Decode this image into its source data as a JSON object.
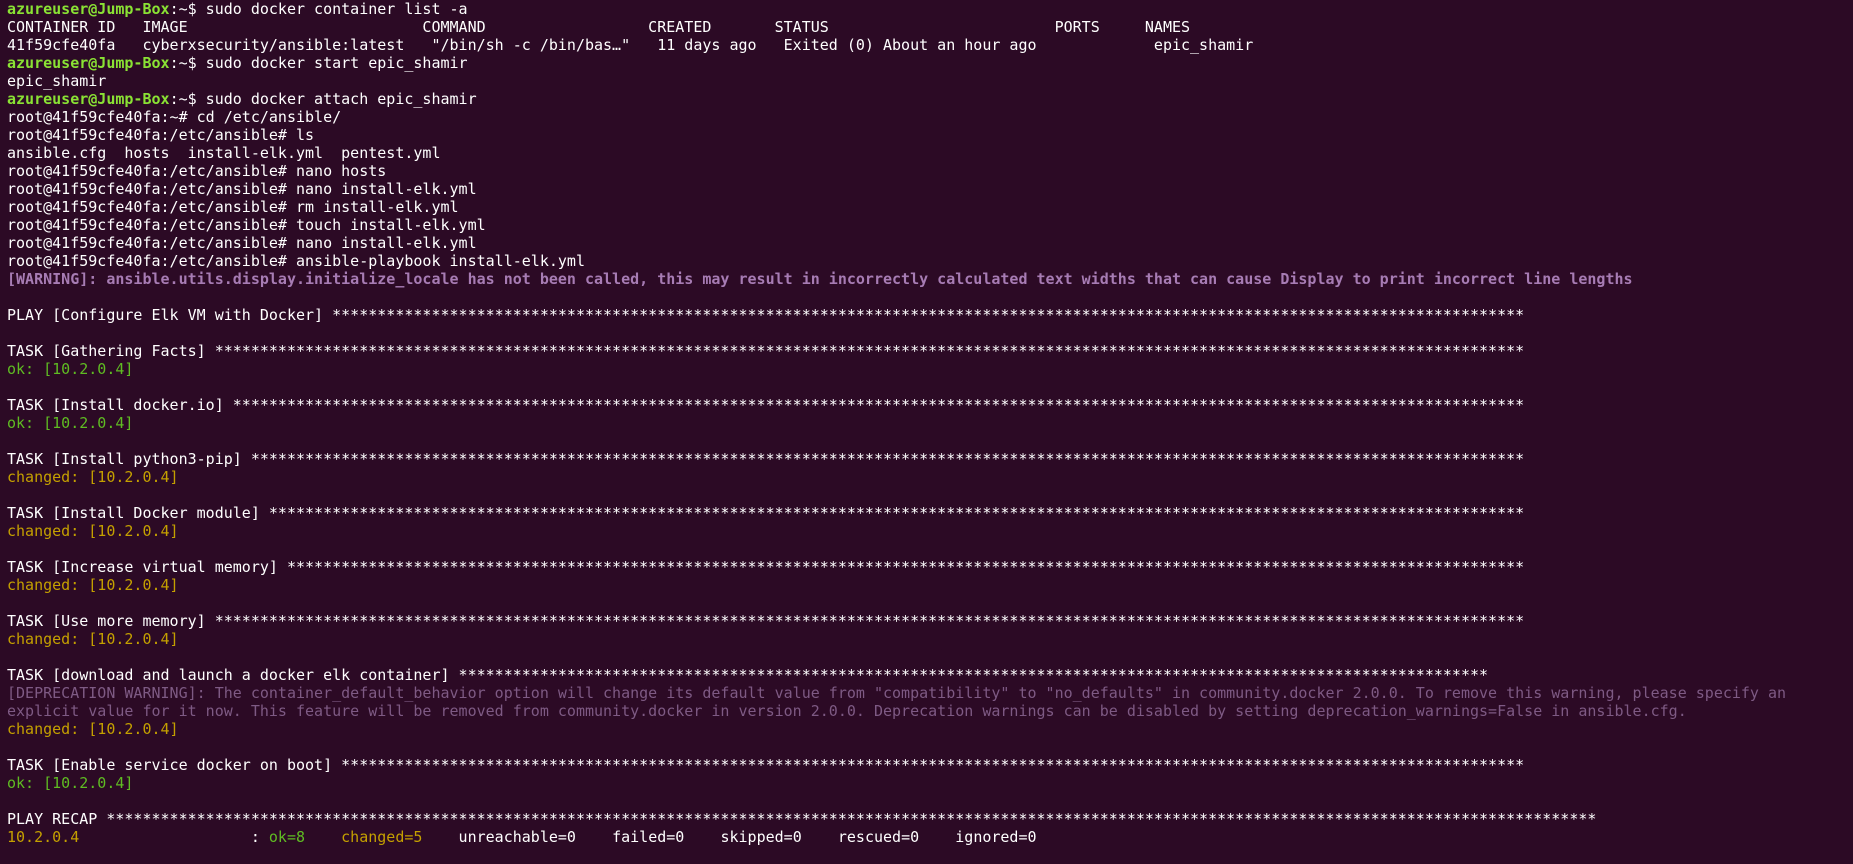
{
  "theme": {
    "background": "#2c0a25",
    "foreground": "#ffffff",
    "prompt_user": "#8ae234",
    "ok": "#5fbc22",
    "changed": "#c4a000",
    "warning": "#a77cb4",
    "deprecation": "#7e5a84"
  },
  "lines": [
    [
      {
        "t": "azureuser@Jump-Box",
        "c": "c-green bold"
      },
      {
        "t": ":~$ sudo docker container list -a",
        "c": "c-white"
      }
    ],
    [
      {
        "t": "CONTAINER ID   IMAGE                          COMMAND                  CREATED       STATUS                         PORTS     NAMES",
        "c": "c-white"
      }
    ],
    [
      {
        "t": "41f59cfe40fa   cyberxsecurity/ansible:latest   \"/bin/sh -c /bin/bas…\"   11 days ago   Exited (0) About an hour ago             epic_shamir",
        "c": "c-white"
      }
    ],
    [
      {
        "t": "azureuser@Jump-Box",
        "c": "c-green bold"
      },
      {
        "t": ":~$ sudo docker start epic_shamir",
        "c": "c-white"
      }
    ],
    [
      {
        "t": "epic_shamir",
        "c": "c-white"
      }
    ],
    [
      {
        "t": "azureuser@Jump-Box",
        "c": "c-green bold"
      },
      {
        "t": ":~$ sudo docker attach epic_shamir",
        "c": "c-white"
      }
    ],
    [
      {
        "t": "root@41f59cfe40fa:~# cd /etc/ansible/",
        "c": "c-white"
      }
    ],
    [
      {
        "t": "root@41f59cfe40fa:/etc/ansible# ls",
        "c": "c-white"
      }
    ],
    [
      {
        "t": "ansible.cfg  hosts  install-elk.yml  pentest.yml",
        "c": "c-white"
      }
    ],
    [
      {
        "t": "root@41f59cfe40fa:/etc/ansible# nano hosts",
        "c": "c-white"
      }
    ],
    [
      {
        "t": "root@41f59cfe40fa:/etc/ansible# nano install-elk.yml",
        "c": "c-white"
      }
    ],
    [
      {
        "t": "root@41f59cfe40fa:/etc/ansible# rm install-elk.yml",
        "c": "c-white"
      }
    ],
    [
      {
        "t": "root@41f59cfe40fa:/etc/ansible# touch install-elk.yml",
        "c": "c-white"
      }
    ],
    [
      {
        "t": "root@41f59cfe40fa:/etc/ansible# nano install-elk.yml",
        "c": "c-white"
      }
    ],
    [
      {
        "t": "root@41f59cfe40fa:/etc/ansible# ansible-playbook install-elk.yml",
        "c": "c-white"
      }
    ],
    [
      {
        "t": "[WARNING]: ansible.utils.display.initialize_locale has not been called, this may result in incorrectly calculated text widths that can cause Display to print incorrect line lengths",
        "c": "c-warn bold"
      }
    ],
    [],
    [
      {
        "t": "PLAY [Configure Elk VM with Docker] ************************************************************************************************************************************",
        "c": "c-white"
      }
    ],
    [],
    [
      {
        "t": "TASK [Gathering Facts] *************************************************************************************************************************************************",
        "c": "c-white"
      }
    ],
    [
      {
        "t": "ok: [10.2.0.4]",
        "c": "c-ok"
      }
    ],
    [],
    [
      {
        "t": "TASK [Install docker.io] ***********************************************************************************************************************************************",
        "c": "c-white"
      }
    ],
    [
      {
        "t": "ok: [10.2.0.4]",
        "c": "c-ok"
      }
    ],
    [],
    [
      {
        "t": "TASK [Install python3-pip] *********************************************************************************************************************************************",
        "c": "c-white"
      }
    ],
    [
      {
        "t": "changed: [10.2.0.4]",
        "c": "c-yellow"
      }
    ],
    [],
    [
      {
        "t": "TASK [Install Docker module] *******************************************************************************************************************************************",
        "c": "c-white"
      }
    ],
    [
      {
        "t": "changed: [10.2.0.4]",
        "c": "c-yellow"
      }
    ],
    [],
    [
      {
        "t": "TASK [Increase virtual memory] *****************************************************************************************************************************************",
        "c": "c-white"
      }
    ],
    [
      {
        "t": "changed: [10.2.0.4]",
        "c": "c-yellow"
      }
    ],
    [],
    [
      {
        "t": "TASK [Use more memory] *************************************************************************************************************************************************",
        "c": "c-white"
      }
    ],
    [
      {
        "t": "changed: [10.2.0.4]",
        "c": "c-yellow"
      }
    ],
    [],
    [
      {
        "t": "TASK [download and launch a docker elk container] ******************************************************************************************************************",
        "c": "c-white"
      }
    ],
    [
      {
        "t": "[DEPRECATION WARNING]: The container_default_behavior option will change its default value from \"compatibility\" to \"no_defaults\" in community.docker 2.0.0. To remove this warning, please specify an",
        "c": "c-dep"
      }
    ],
    [
      {
        "t": "explicit value for it now. This feature will be removed from community.docker in version 2.0.0. Deprecation warnings can be disabled by setting deprecation_warnings=False in ansible.cfg.",
        "c": "c-dep"
      }
    ],
    [
      {
        "t": "changed: [10.2.0.4]",
        "c": "c-yellow"
      }
    ],
    [],
    [
      {
        "t": "TASK [Enable service docker on boot] ***********************************************************************************************************************************",
        "c": "c-white"
      }
    ],
    [
      {
        "t": "ok: [10.2.0.4]",
        "c": "c-ok"
      }
    ],
    [],
    [
      {
        "t": "PLAY RECAP *********************************************************************************************************************************************************************",
        "c": "c-white"
      }
    ],
    [
      {
        "t": "10.2.0.4",
        "c": "c-yellow"
      },
      {
        "t": "                   : ",
        "c": "c-white"
      },
      {
        "t": "ok=8",
        "c": "c-ok"
      },
      {
        "t": "    ",
        "c": "c-white"
      },
      {
        "t": "changed=5",
        "c": "c-yellow"
      },
      {
        "t": "    unreachable=0    failed=0    skipped=0    rescued=0    ignored=0",
        "c": "c-white"
      }
    ]
  ]
}
